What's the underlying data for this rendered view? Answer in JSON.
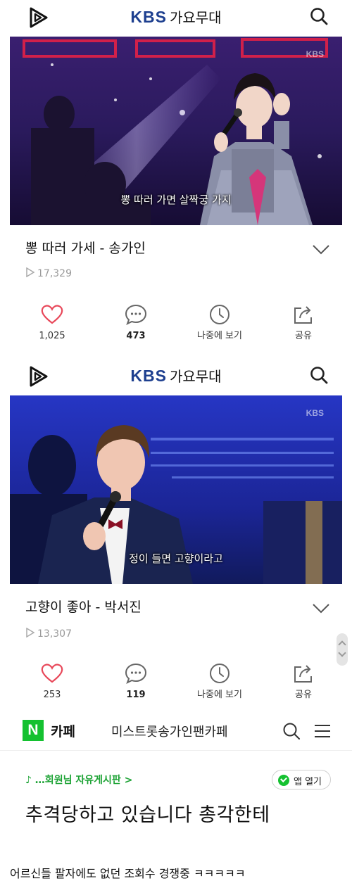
{
  "header": {
    "brand_kbs": "KBS",
    "brand_show": "가요무대"
  },
  "videos": [
    {
      "subtitle": "뽕 따러 가면 살짝궁 가지",
      "watermark": "KBS",
      "title": "뽕 따러 가세 - 송가인",
      "views": "17,329",
      "likes": "1,025",
      "comments": "473",
      "watch_later": "나중에 보기",
      "share": "공유"
    },
    {
      "subtitle": "정이 들면 고향이라고",
      "watermark": "KBS",
      "title": "고향이 좋아 - 박서진",
      "views": "13,307",
      "likes": "253",
      "comments": "119",
      "watch_later": "나중에 보기",
      "share": "공유"
    }
  ],
  "cafe": {
    "logo": "N",
    "label": "카페",
    "name": "미스트롯송가인팬카페",
    "board": "♪ …회원님 자유게시판 >",
    "app_open": "앱 열기",
    "post_title": "추격당하고 있습니다 총각한테"
  },
  "caption": "어르신들 팔자에도 없던 조회수 경쟁중 ㅋㅋㅋㅋㅋ",
  "colors": {
    "kbs_blue": "#1d3f8f",
    "like_red": "#e8485a",
    "naver_green": "#14c130",
    "views_gray": "#9a9a9a"
  },
  "icons": [
    "play-logo-icon",
    "search-icon",
    "chevron-down-icon",
    "heart-icon",
    "comment-icon",
    "clock-icon",
    "share-icon",
    "menu-icon",
    "check-icon"
  ]
}
